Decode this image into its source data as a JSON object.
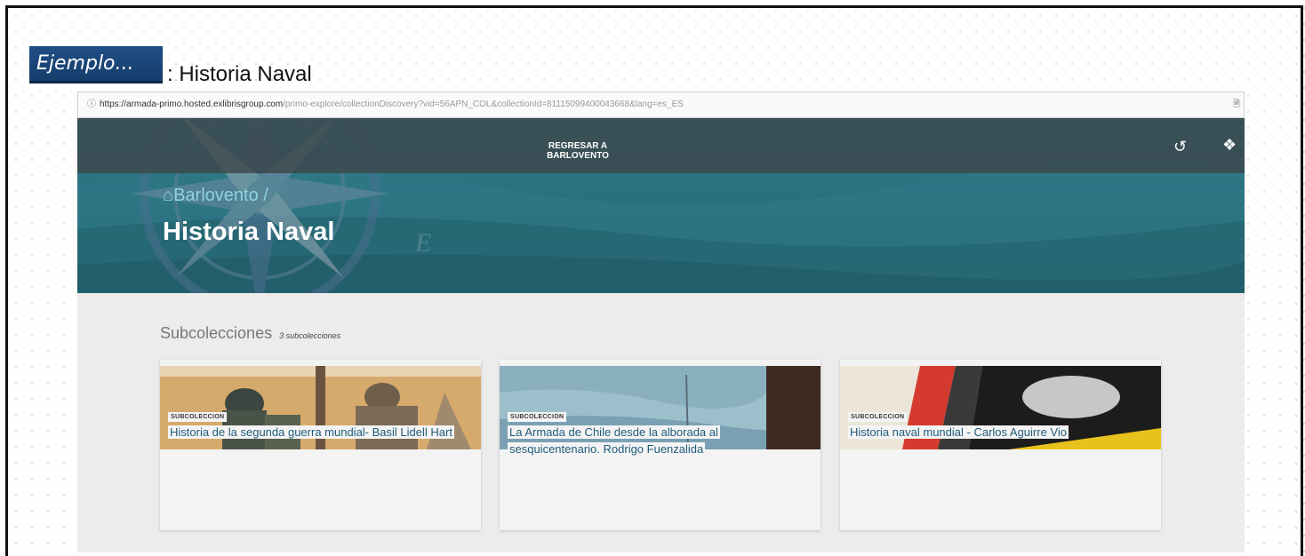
{
  "header": {
    "badge_text": "Ejemplo...",
    "title": ": Historia Naval"
  },
  "browser": {
    "url_domain": "https://armada-primo.hosted.exlibrisgroup.com",
    "url_path": "/primo-explore/collectionDiscovery?vid=56APN_COL&collectionId=81115099400043668&lang=es_ES"
  },
  "topbar": {
    "return_line1": "REGRESAR A",
    "return_line2": "BARLOVENTO"
  },
  "hero": {
    "breadcrumb": "Barlovento /",
    "collection_title": "Historia Naval"
  },
  "subcollections": {
    "heading": "Subcolecciones",
    "count": "3 subcolecciones",
    "items": [
      {
        "tag": "SUBCOLECCION",
        "title": "Historia de la segunda guerra mundial- Basil Lidell Hart"
      },
      {
        "tag": "SUBCOLECCION",
        "title": "La Armada de Chile desde la alborada al sesquicentenario. Rodrigo Fuenzalida"
      },
      {
        "tag": "SUBCOLECCION",
        "title": "Historia naval mundial - Carlos Aguirre Vio"
      }
    ]
  },
  "icons": {
    "info": "info-icon",
    "history": "history-icon",
    "pin": "pin-icon",
    "home": "home-icon"
  },
  "colors": {
    "badge": "#1f4e86",
    "hero": "#2b6f7c",
    "breadcrumb": "#8fd2e4",
    "card_title": "#1f5b7a"
  }
}
